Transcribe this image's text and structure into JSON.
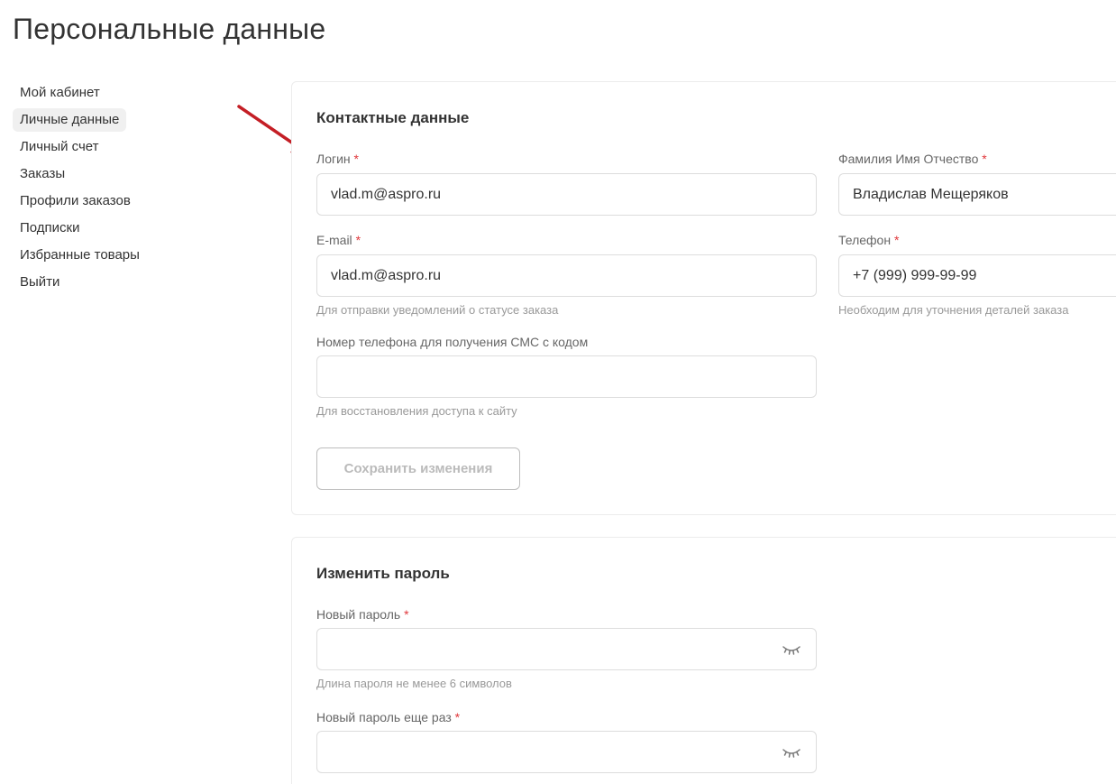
{
  "page": {
    "title": "Персональные данные"
  },
  "sidebar": {
    "items": [
      {
        "label": "Мой кабинет",
        "active": false
      },
      {
        "label": "Личные данные",
        "active": true
      },
      {
        "label": "Личный счет",
        "active": false
      },
      {
        "label": "Заказы",
        "active": false
      },
      {
        "label": "Профили заказов",
        "active": false
      },
      {
        "label": "Подписки",
        "active": false
      },
      {
        "label": "Избранные товары",
        "active": false
      },
      {
        "label": "Выйти",
        "active": false
      }
    ]
  },
  "contact": {
    "title": "Контактные данные",
    "login": {
      "label": "Логин",
      "value": "vlad.m@aspro.ru"
    },
    "fio": {
      "label": "Фамилия Имя Отчество",
      "value": "Владислав Мещеряков"
    },
    "email": {
      "label": "E-mail",
      "value": "vlad.m@aspro.ru",
      "hint": "Для отправки уведомлений о статусе заказа"
    },
    "phone": {
      "label": "Телефон",
      "value": "+7 (999) 999-99-99",
      "hint": "Необходим для уточнения деталей заказа"
    },
    "sms_phone": {
      "label": "Номер телефона для получения СМС с кодом",
      "value": "",
      "hint": "Для восстановления доступа к сайту"
    },
    "save_label": "Сохранить изменения"
  },
  "password": {
    "title": "Изменить пароль",
    "new": {
      "label": "Новый пароль",
      "value": "",
      "hint": "Длина пароля не менее 6 символов"
    },
    "repeat": {
      "label": "Новый пароль еще раз",
      "value": ""
    }
  },
  "required_mark": "*",
  "colors": {
    "required": "#e0383c",
    "arrow": "#c41e25",
    "active_bg": "#f0f0f0"
  },
  "icons": {
    "password_toggle": "eye-closed-icon",
    "annotation": "arrow-icon"
  }
}
